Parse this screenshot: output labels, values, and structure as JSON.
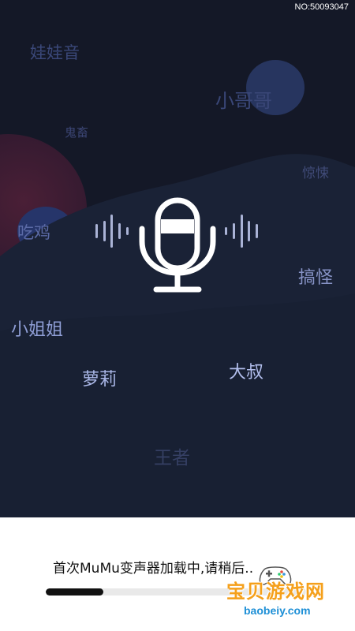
{
  "status": {
    "no_label": "NO:50093047"
  },
  "voice_tags": {
    "baby": "娃娃音",
    "bro": "小哥哥",
    "ghost": "鬼畜",
    "thrill": "惊悚",
    "chicken": "吃鸡",
    "funny": "搞怪",
    "sister": "小姐姐",
    "loli": "萝莉",
    "uncle": "大叔",
    "king": "王者"
  },
  "center_icon": "microphone-icon",
  "loading": {
    "text": "首次MuMu变声器加载中,请稍后..",
    "progress": 0.22
  },
  "watermark": {
    "main": "宝贝游戏网",
    "url": "baobeiy.com",
    "icon": "gamepad-icon"
  },
  "colors": {
    "background": "#141827",
    "accent": "#f5a01b",
    "link": "#1d8fd6"
  }
}
